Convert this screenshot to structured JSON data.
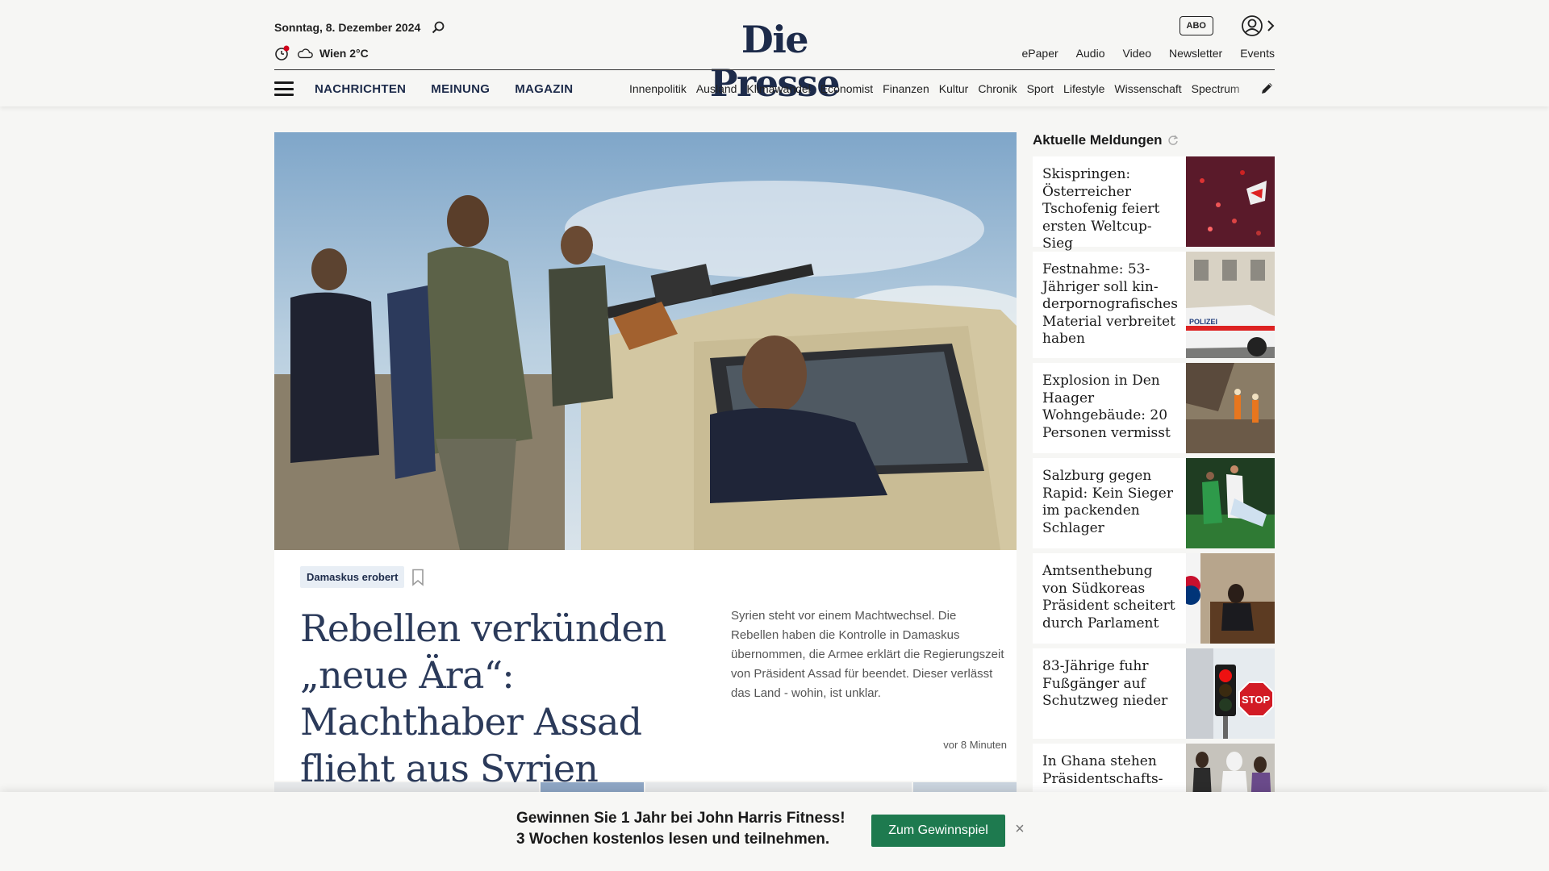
{
  "header": {
    "date": "Sonntag, 8. Dezember 2024",
    "weather": "Wien 2°C",
    "logo": "Die Presse",
    "abo_label": "ABO",
    "top_links": [
      "ePaper",
      "Audio",
      "Video",
      "Newsletter",
      "Events"
    ],
    "nav_main": [
      "NACHRICHTEN",
      "MEINUNG",
      "MAGAZIN"
    ],
    "nav_sub": [
      "Innenpolitik",
      "Ausland",
      "Klimawandel",
      "Economist",
      "Finanzen",
      "Kultur",
      "Chronik",
      "Sport",
      "Lifestyle",
      "Wissenschaft",
      "Spectrum"
    ]
  },
  "article": {
    "tag": "Damaskus erobert",
    "headline": "Rebellen verkünden „neue Ära“: Machthaber Assad flieht aus Syrien",
    "teaser": "Syrien steht vor einem Machtwechsel. Die Rebellen haben die Kontrolle in Damaskus übernommen, die Armee erklärt die Regierungszeit von Präsident Assad für beendet. Dieser verlässt das Land - wohin, ist unklar.",
    "time": "vor 8 Minuten"
  },
  "sidebar": {
    "title": "Aktuelle Meldungen",
    "items": [
      {
        "text": "Skispringen: Österreicher Tschofenig feiert ersten Weltcup-Sieg"
      },
      {
        "text": "Festnahme: 53-Jähriger soll kin-derpornografisches Material verbreitet haben"
      },
      {
        "text": "Explosion in Den Haager Wohngebäude: 20 Personen vermisst"
      },
      {
        "text": "Salzburg gegen Rapid: Kein Sieger im packenden Schlager"
      },
      {
        "text": "Amtsenthebung von Südkoreas Präsident scheitert durch Parlament"
      },
      {
        "text": "83-Jährige fuhr Fußgänger auf Schutzweg nieder"
      },
      {
        "text": "In Ghana stehen Präsidentschafts-"
      }
    ]
  },
  "banner": {
    "line1": "Gewinnen Sie 1 Jahr bei John Harris Fitness!",
    "line2": "3 Wochen kostenlos lesen und teilnehmen.",
    "button": "Zum Gewinnspiel",
    "close": "×"
  },
  "colors": {
    "brand": "#1d2b4a",
    "cta": "#1e7a4f",
    "alert": "#d0021b"
  }
}
